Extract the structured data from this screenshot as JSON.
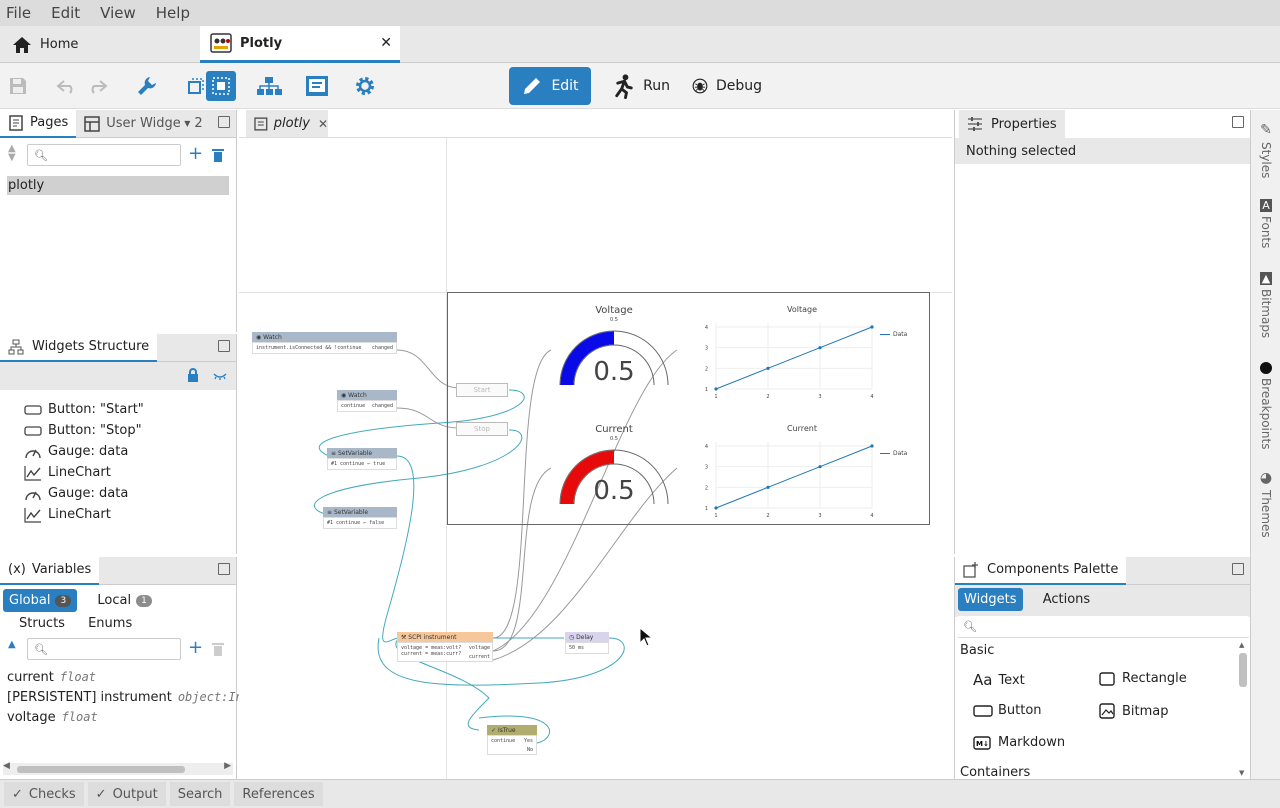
{
  "menu": [
    "File",
    "Edit",
    "View",
    "Help"
  ],
  "tabs": {
    "home": "Home",
    "plotly": "Plotly"
  },
  "modes": {
    "edit": "Edit",
    "run": "Run",
    "debug": "Debug"
  },
  "pages_panel": {
    "tab_pages": "Pages",
    "tab_user_widgets": "User Widgets",
    "badge": "2",
    "items": [
      "plotly"
    ]
  },
  "widgets_structure": {
    "title": "Widgets Structure",
    "items": [
      {
        "icon": "button-icon",
        "label": "Button: \"Start\""
      },
      {
        "icon": "button-icon",
        "label": "Button: \"Stop\""
      },
      {
        "icon": "gauge-icon",
        "label": "Gauge: data"
      },
      {
        "icon": "linechart-icon",
        "label": "LineChart"
      },
      {
        "icon": "gauge-icon",
        "label": "Gauge: data"
      },
      {
        "icon": "linechart-icon",
        "label": "LineChart"
      }
    ]
  },
  "variables": {
    "title": "Variables",
    "tabs": [
      {
        "label": "Global",
        "count": "3"
      },
      {
        "label": "Local",
        "count": "1"
      },
      {
        "label": "Structs"
      },
      {
        "label": "Enums"
      }
    ],
    "items": [
      {
        "name": "current",
        "type": "float"
      },
      {
        "name": "[PERSISTENT] instrument",
        "type": "object:Ins"
      },
      {
        "name": "voltage",
        "type": "float"
      }
    ]
  },
  "editor_tab": "plotly",
  "properties": {
    "title": "Properties",
    "empty": "Nothing selected"
  },
  "palette": {
    "title": "Components Palette",
    "tabs": [
      "Widgets",
      "Actions"
    ],
    "section_basic": "Basic",
    "section_containers": "Containers",
    "items": [
      {
        "icon": "text-icon",
        "label": "Text"
      },
      {
        "icon": "rectangle-icon",
        "label": "Rectangle"
      },
      {
        "icon": "button-icon",
        "label": "Button"
      },
      {
        "icon": "bitmap-icon",
        "label": "Bitmap"
      },
      {
        "icon": "markdown-icon",
        "label": "Markdown"
      }
    ]
  },
  "side_tabs": [
    "Styles",
    "Fonts",
    "Bitmaps",
    "Breakpoints",
    "Themes"
  ],
  "bottom_tabs": [
    "Checks",
    "Output",
    "Search",
    "References"
  ],
  "canvas": {
    "gauge1": {
      "title": "Voltage",
      "value": "0.5",
      "max_label": "0.5"
    },
    "gauge2": {
      "title": "Current",
      "value": "0.5",
      "max_label": "0.5"
    },
    "chart1": {
      "title": "Voltage",
      "legend": "Data"
    },
    "chart2": {
      "title": "Current",
      "legend": "Data"
    },
    "buttons": {
      "start": "Start",
      "stop": "Stop"
    },
    "nodes": {
      "watch1": {
        "title": "Watch",
        "body": "instrument.isConnected && !continue",
        "out": "changed"
      },
      "watch2": {
        "title": "Watch",
        "body": "continue",
        "out": "changed"
      },
      "setvar1": {
        "title": "SetVariable",
        "body": "#1 continue ← true"
      },
      "setvar2": {
        "title": "SetVariable",
        "body": "#1 continue ← false"
      },
      "scpi": {
        "title": "SCPI instrument",
        "line1": "voltage = meas:volt?",
        "line2": "current = meas:curr?",
        "out1": "voltage",
        "out2": "current"
      },
      "delay": {
        "title": "Delay",
        "body": "50 ms"
      },
      "istrue": {
        "title": "IsTrue",
        "body": "continue",
        "yes": "Yes",
        "no": "No"
      }
    }
  },
  "chart_data": [
    {
      "type": "line",
      "title": "Voltage",
      "x": [
        1,
        2,
        3,
        4
      ],
      "series": [
        {
          "name": "Data",
          "values": [
            1,
            2,
            3,
            4
          ]
        }
      ],
      "ylim": [
        1,
        4
      ],
      "xticks": [
        "1",
        "2",
        "3",
        "4"
      ],
      "yticks": [
        "1",
        "2",
        "3",
        "4"
      ]
    },
    {
      "type": "line",
      "title": "Current",
      "x": [
        1,
        2,
        3,
        4
      ],
      "series": [
        {
          "name": "Data",
          "values": [
            1,
            2,
            3,
            4
          ]
        }
      ],
      "ylim": [
        1,
        4
      ],
      "xticks": [
        "1",
        "2",
        "3",
        "4"
      ],
      "yticks": [
        "1",
        "2",
        "3",
        "4"
      ]
    }
  ],
  "colors": {
    "accent": "#2a7fc1",
    "gauge_voltage": "#0a0ae6",
    "gauge_current": "#e60a0a"
  }
}
